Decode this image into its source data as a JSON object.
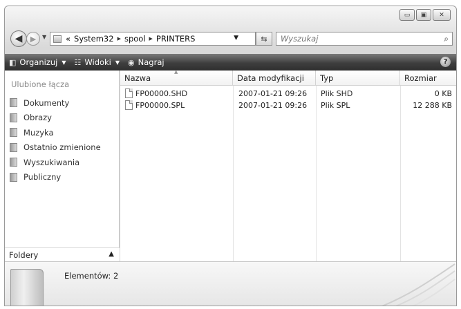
{
  "address": {
    "overflow_marker": "«",
    "crumbs": [
      "System32",
      "spool",
      "PRINTERS"
    ]
  },
  "search": {
    "placeholder": "Wyszukaj"
  },
  "toolbar": {
    "organize": "Organizuj",
    "views": "Widoki",
    "burn": "Nagraj",
    "help": "?"
  },
  "navpane": {
    "title": "Ulubione łącza",
    "items": [
      "Dokumenty",
      "Obrazy",
      "Muzyka",
      "Ostatnio zmienione",
      "Wyszukiwania",
      "Publiczny"
    ],
    "folders_label": "Foldery"
  },
  "columns": {
    "name": "Nazwa",
    "date": "Data modyfikacji",
    "type": "Typ",
    "size": "Rozmiar"
  },
  "files": [
    {
      "name": "FP00000.SHD",
      "date": "2007-01-21 09:26",
      "type": "Plik SHD",
      "size": "0 KB"
    },
    {
      "name": "FP00000.SPL",
      "date": "2007-01-21 09:26",
      "type": "Plik SPL",
      "size": "12 288 KB"
    }
  ],
  "details": {
    "item_count": "Elementów: 2"
  }
}
